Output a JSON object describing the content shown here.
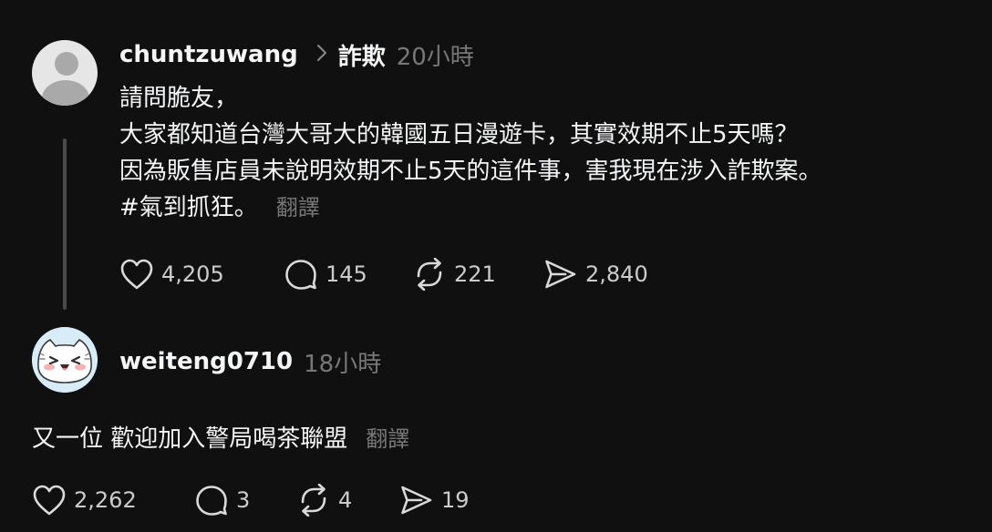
{
  "post": {
    "username": "chuntzuwang",
    "topic": "詐欺",
    "time": "20小時",
    "lines": [
      "請問脆友，",
      "大家都知道台灣大哥大的韓國五日漫遊卡，其實效期不止5天嗎？",
      "因為販售店員未說明效期不止5天的這件事，害我現在涉入詐欺案。",
      "#氣到抓狂。"
    ],
    "translate": "翻譯",
    "likes": "4,205",
    "comments": "145",
    "reposts": "221",
    "shares": "2,840"
  },
  "reply": {
    "username": "weiteng0710",
    "time": "18小時",
    "text": "又一位 歡迎加入警局喝茶聯盟",
    "translate": "翻譯",
    "likes": "2,262",
    "comments": "3",
    "reposts": "4",
    "shares": "19"
  },
  "colors": {
    "background": "#101010",
    "text": "#f3f5f7",
    "muted": "#777777",
    "thread_line": "#4a4a4a"
  },
  "icons": [
    "avatar-default-icon",
    "chevron-right-icon",
    "heart-icon",
    "comment-icon",
    "repost-icon",
    "share-icon"
  ]
}
